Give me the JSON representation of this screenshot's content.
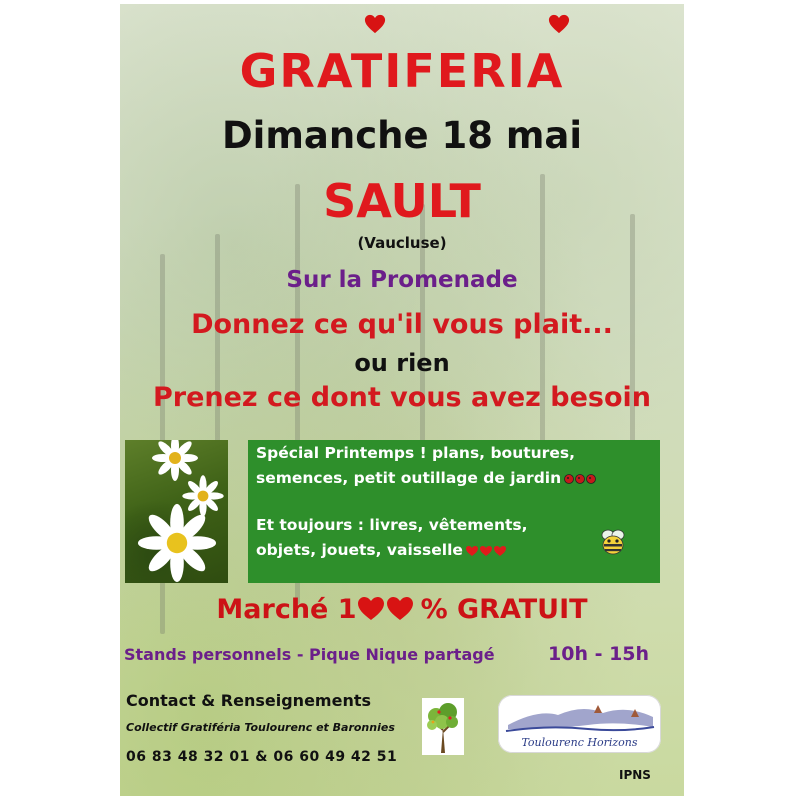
{
  "poster": {
    "title": "GRATIFERIA",
    "date": "Dimanche 18 mai",
    "city": "SAULT",
    "region": "(Vaucluse)",
    "venue": "Sur la Promenade",
    "give_line": "Donnez ce qu'il vous plait...",
    "or_line": "ou rien",
    "take_line": "Prenez ce dont vous avez besoin"
  },
  "green_box": {
    "line1": "Spécial Printemps ! plans, boutures,",
    "line2": "semences, petit outillage de jardin",
    "line3": "Et toujours : livres, vêtements,",
    "line4": "objets, jouets, vaisselle"
  },
  "market": {
    "prefix": "Marché 1",
    "suffix": "% GRATUIT"
  },
  "details": {
    "stands": "Stands personnels - Pique Nique partagé",
    "hours": "10h - 15h"
  },
  "contact": {
    "title": "Contact & Renseignements",
    "collective": "Collectif Gratiféria Toulourenc et Baronnies",
    "phones": "06 83 48 32 01 & 06 60 49 42 51"
  },
  "logos": {
    "org_name": "Toulourenc Horizons"
  },
  "footer": {
    "ipns": "IPNS"
  },
  "colors": {
    "red": "#e0191d",
    "purple": "#6b1f8a",
    "green_box": "#2e8f2b"
  },
  "icons": [
    "heart-icon",
    "ladybug-icon",
    "bee-icon",
    "flower-photo",
    "tree-logo"
  ]
}
